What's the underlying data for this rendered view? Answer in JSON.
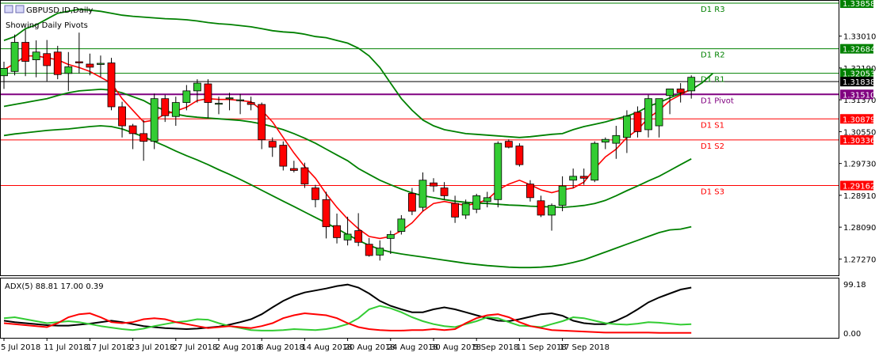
{
  "header": {
    "symbol_label": "GBPUSD.ID,Daily",
    "subtitle": "Showing Daily Pivots",
    "indicator_label": "ADX(5) 88.81 17.00 0.39"
  },
  "colors": {
    "bull": "#33cc33",
    "bear": "#ff0000",
    "bollinger": "#008000",
    "ma": "#ff0000",
    "pivot_green": "#008000",
    "pivot_purple": "#800080",
    "pivot_red": "#ff0000",
    "adx_main": "#000000",
    "adx_plus": "#33cc33",
    "adx_minus": "#ff0000"
  },
  "chart_data": [
    {
      "type": "candlestick",
      "title": "GBPUSD.ID,Daily",
      "y_ticks": [
        "1.33010",
        "1.32190",
        "1.31370",
        "1.30550",
        "1.29730",
        "1.28910",
        "1.28090",
        "1.27270"
      ],
      "x_tick_labels": [
        "5 Jul 2018",
        "11 Jul 2018",
        "17 Jul 2018",
        "23 Jul 2018",
        "27 Jul 2018",
        "2 Aug 2018",
        "8 Aug 2018",
        "14 Aug 2018",
        "20 Aug 2018",
        "24 Aug 2018",
        "30 Aug 2018",
        "5 Sep 2018",
        "11 Sep 2018",
        "17 Sep 2018"
      ],
      "ylim": [
        1.2685,
        1.3392
      ],
      "pivots": [
        {
          "name": "D1 R3",
          "value": 1.33858,
          "tag": "1.33858",
          "color": "pivot_green"
        },
        {
          "name": "D1 R2",
          "value": 1.32684,
          "tag": "1.32684",
          "color": "pivot_green"
        },
        {
          "name": "D1 R1",
          "value": 1.32053,
          "tag": "1.32053",
          "color": "pivot_green"
        },
        {
          "name": "D1 Pivot",
          "value": 1.3151,
          "tag": "1.31510",
          "color": "pivot_purple"
        },
        {
          "name": "D1 S1",
          "value": 1.30879,
          "tag": "1.30879",
          "color": "pivot_red"
        },
        {
          "name": "D1 S2",
          "value": 1.30336,
          "tag": "1.30336",
          "color": "pivot_red"
        },
        {
          "name": "D1 S3",
          "value": 1.29162,
          "tag": "1.29162",
          "color": "pivot_red"
        }
      ],
      "current_price_tag": "1.31838",
      "current_price": 1.31838,
      "ohlc": [
        [
          1.3199,
          1.3235,
          1.3165,
          1.3218
        ],
        [
          1.321,
          1.3305,
          1.32,
          1.3285
        ],
        [
          1.3285,
          1.3318,
          1.3198,
          1.3236
        ],
        [
          1.324,
          1.329,
          1.3195,
          1.326
        ],
        [
          1.3256,
          1.3291,
          1.3185,
          1.3225
        ],
        [
          1.326,
          1.3276,
          1.319,
          1.3202
        ],
        [
          1.3205,
          1.326,
          1.316,
          1.3222
        ],
        [
          1.3235,
          1.331,
          1.3205,
          1.3232
        ],
        [
          1.3229,
          1.3256,
          1.32,
          1.3221
        ],
        [
          1.3228,
          1.3251,
          1.3196,
          1.3231
        ],
        [
          1.3232,
          1.3245,
          1.311,
          1.3119
        ],
        [
          1.3119,
          1.3132,
          1.304,
          1.307
        ],
        [
          1.307,
          1.3075,
          1.301,
          1.305
        ],
        [
          1.305,
          1.3085,
          1.298,
          1.303
        ],
        [
          1.303,
          1.3153,
          1.301,
          1.314
        ],
        [
          1.314,
          1.315,
          1.308,
          1.3096
        ],
        [
          1.3094,
          1.3145,
          1.307,
          1.313
        ],
        [
          1.313,
          1.3175,
          1.311,
          1.316
        ],
        [
          1.316,
          1.319,
          1.313,
          1.318
        ],
        [
          1.3178,
          1.319,
          1.309,
          1.313
        ],
        [
          1.3127,
          1.3145,
          1.31,
          1.3128
        ],
        [
          1.314,
          1.3155,
          1.311,
          1.3142
        ],
        [
          1.3135,
          1.3152,
          1.31,
          1.3137
        ],
        [
          1.313,
          1.3145,
          1.311,
          1.3125
        ],
        [
          1.3125,
          1.313,
          1.301,
          1.3034
        ],
        [
          1.303,
          1.304,
          1.299,
          1.3015
        ],
        [
          1.302,
          1.303,
          1.2955,
          1.2966
        ],
        [
          1.296,
          1.298,
          1.295,
          1.2955
        ],
        [
          1.2962,
          1.2975,
          1.291,
          1.292
        ],
        [
          1.291,
          1.2918,
          1.286,
          1.288
        ],
        [
          1.288,
          1.29,
          1.278,
          1.281
        ],
        [
          1.2813,
          1.2844,
          1.2767,
          1.2782
        ],
        [
          1.2776,
          1.2836,
          1.2762,
          1.2791
        ],
        [
          1.28,
          1.2845,
          1.276,
          1.277
        ],
        [
          1.2765,
          1.2781,
          1.2733,
          1.2736
        ],
        [
          1.2737,
          1.2775,
          1.2723,
          1.2755
        ],
        [
          1.278,
          1.28,
          1.274,
          1.279
        ],
        [
          1.2798,
          1.284,
          1.279,
          1.283
        ],
        [
          1.2896,
          1.291,
          1.284,
          1.285
        ],
        [
          1.286,
          1.295,
          1.285,
          1.293
        ],
        [
          1.2923,
          1.2935,
          1.29,
          1.2915
        ],
        [
          1.291,
          1.2925,
          1.288,
          1.289
        ],
        [
          1.287,
          1.289,
          1.282,
          1.2835
        ],
        [
          1.284,
          1.288,
          1.283,
          1.287
        ],
        [
          1.2855,
          1.2895,
          1.2845,
          1.289
        ],
        [
          1.2875,
          1.29,
          1.286,
          1.2885
        ],
        [
          1.288,
          1.303,
          1.286,
          1.3025
        ],
        [
          1.303,
          1.3035,
          1.3012,
          1.3015
        ],
        [
          1.3018,
          1.3025,
          1.2965,
          1.297
        ],
        [
          1.292,
          1.293,
          1.2875,
          1.2885
        ],
        [
          1.2877,
          1.289,
          1.2835,
          1.284
        ],
        [
          1.284,
          1.287,
          1.28,
          1.2865
        ],
        [
          1.2865,
          1.294,
          1.285,
          1.2915
        ],
        [
          1.293,
          1.296,
          1.291,
          1.294
        ],
        [
          1.294,
          1.296,
          1.2918,
          1.2935
        ],
        [
          1.293,
          1.303,
          1.2925,
          1.3025
        ],
        [
          1.3028,
          1.304,
          1.301,
          1.3035
        ],
        [
          1.3025,
          1.307,
          1.2985,
          1.3045
        ],
        [
          1.304,
          1.311,
          1.3,
          1.3095
        ],
        [
          1.3105,
          1.312,
          1.304,
          1.3055
        ],
        [
          1.306,
          1.315,
          1.304,
          1.314
        ],
        [
          1.307,
          1.313,
          1.304,
          1.314
        ],
        [
          1.3148,
          1.3165,
          1.31,
          1.3165
        ],
        [
          1.3165,
          1.318,
          1.313,
          1.3155
        ],
        [
          1.316,
          1.32,
          1.314,
          1.3195
        ]
      ],
      "upper_band": [
        1.329,
        1.33,
        1.332,
        1.333,
        1.3345,
        1.336,
        1.3365,
        1.337,
        1.3368,
        1.3365,
        1.336,
        1.3355,
        1.3352,
        1.335,
        1.3348,
        1.3346,
        1.3345,
        1.3343,
        1.334,
        1.3336,
        1.3333,
        1.3331,
        1.3328,
        1.3325,
        1.332,
        1.3315,
        1.3312,
        1.331,
        1.3306,
        1.33,
        1.3297,
        1.329,
        1.3283,
        1.327,
        1.325,
        1.322,
        1.318,
        1.314,
        1.311,
        1.3085,
        1.307,
        1.306,
        1.3055,
        1.305,
        1.3048,
        1.3046,
        1.3044,
        1.3042,
        1.304,
        1.3042,
        1.3045,
        1.3048,
        1.305,
        1.306,
        1.3068,
        1.3074,
        1.308,
        1.3088,
        1.3095,
        1.3105,
        1.312,
        1.313,
        1.3142,
        1.3153,
        1.3163,
        1.3181,
        1.3205
      ],
      "middle_band": [
        1.312,
        1.3125,
        1.313,
        1.3135,
        1.314,
        1.3148,
        1.3155,
        1.316,
        1.3162,
        1.3164,
        1.3162,
        1.3155,
        1.3145,
        1.3135,
        1.312,
        1.311,
        1.31,
        1.3095,
        1.3092,
        1.309,
        1.3088,
        1.3086,
        1.3084,
        1.308,
        1.3075,
        1.3068,
        1.306,
        1.305,
        1.3038,
        1.3025,
        1.301,
        1.2995,
        1.298,
        1.296,
        1.2945,
        1.293,
        1.2918,
        1.2907,
        1.2897,
        1.289,
        1.2885,
        1.288,
        1.2876,
        1.2873,
        1.2871,
        1.287,
        1.2868,
        1.2866,
        1.2865,
        1.2863,
        1.2862,
        1.2861,
        1.286,
        1.2862,
        1.2865,
        1.287,
        1.2878,
        1.289,
        1.2903,
        1.2915,
        1.2928,
        1.294,
        1.2955,
        1.297,
        1.2985
      ],
      "lower_band": [
        1.3045,
        1.3049,
        1.3052,
        1.3055,
        1.3058,
        1.306,
        1.3062,
        1.3065,
        1.3068,
        1.307,
        1.3068,
        1.3062,
        1.3052,
        1.3042,
        1.303,
        1.3018,
        1.3005,
        1.2993,
        1.2982,
        1.297,
        1.2957,
        1.2945,
        1.2932,
        1.2918,
        1.2904,
        1.289,
        1.2876,
        1.2862,
        1.2848,
        1.2834,
        1.282,
        1.2805,
        1.279,
        1.2775,
        1.2762,
        1.2752,
        1.2745,
        1.274,
        1.2736,
        1.2732,
        1.2728,
        1.2724,
        1.272,
        1.2716,
        1.2713,
        1.271,
        1.2708,
        1.2706,
        1.2705,
        1.2705,
        1.2706,
        1.2708,
        1.2712,
        1.2718,
        1.2725,
        1.2735,
        1.2745,
        1.2755,
        1.2765,
        1.2775,
        1.2785,
        1.2795,
        1.2802,
        1.2804,
        1.281
      ],
      "ma_line": [
        1.3215,
        1.323,
        1.325,
        1.325,
        1.3245,
        1.324,
        1.3228,
        1.322,
        1.321,
        1.3195,
        1.318,
        1.314,
        1.311,
        1.308,
        1.3085,
        1.31,
        1.3108,
        1.3118,
        1.3135,
        1.314,
        1.3138,
        1.3138,
        1.3135,
        1.3132,
        1.311,
        1.308,
        1.304,
        1.3,
        1.2965,
        1.2935,
        1.2895,
        1.286,
        1.283,
        1.2805,
        1.2785,
        1.278,
        1.2785,
        1.28,
        1.282,
        1.285,
        1.287,
        1.2875,
        1.287,
        1.2865,
        1.287,
        1.288,
        1.2905,
        1.292,
        1.293,
        1.2918,
        1.2905,
        1.2898,
        1.2905,
        1.291,
        1.2925,
        1.296,
        1.299,
        1.301,
        1.304,
        1.306,
        1.309,
        1.311,
        1.3135,
        1.315,
        1.3165
      ]
    },
    {
      "type": "line",
      "title": "ADX(5) 88.81 17.00 0.39",
      "y_ticks": [
        "99.18",
        "0.00"
      ],
      "ylim": [
        0,
        99.18
      ],
      "series": [
        {
          "name": "ADX",
          "color": "adx_main",
          "values": [
            25,
            22,
            20,
            18,
            16,
            15,
            15,
            17,
            19,
            22,
            25,
            22,
            18,
            14,
            12,
            10,
            9,
            8,
            9,
            11,
            13,
            17,
            22,
            28,
            38,
            52,
            65,
            75,
            82,
            86,
            90,
            95,
            98,
            92,
            80,
            65,
            55,
            48,
            42,
            42,
            48,
            52,
            48,
            42,
            36,
            30,
            25,
            24,
            28,
            33,
            38,
            40,
            35,
            25,
            20,
            18,
            18,
            25,
            35,
            48,
            62,
            72,
            80,
            88,
            92
          ]
        },
        {
          "name": "+DI",
          "color": "adx_plus",
          "values": [
            30,
            32,
            28,
            24,
            20,
            22,
            24,
            22,
            18,
            14,
            11,
            8,
            6,
            9,
            14,
            18,
            22,
            24,
            28,
            27,
            20,
            14,
            10,
            6,
            5,
            5,
            6,
            8,
            7,
            6,
            8,
            12,
            18,
            30,
            48,
            55,
            50,
            42,
            32,
            24,
            18,
            14,
            12,
            18,
            24,
            32,
            30,
            22,
            15,
            14,
            12,
            18,
            24,
            32,
            30,
            25,
            20,
            18,
            17,
            19,
            22,
            21,
            19,
            17,
            18
          ]
        },
        {
          "name": "-DI",
          "color": "adx_minus",
          "values": [
            20,
            18,
            16,
            14,
            12,
            20,
            32,
            38,
            40,
            32,
            22,
            20,
            22,
            28,
            30,
            28,
            22,
            18,
            14,
            10,
            12,
            14,
            12,
            10,
            14,
            20,
            30,
            36,
            40,
            38,
            36,
            30,
            20,
            12,
            8,
            6,
            5,
            5,
            6,
            6,
            8,
            6,
            8,
            20,
            30,
            36,
            38,
            32,
            22,
            14,
            10,
            6,
            5,
            4,
            3,
            2,
            1,
            1,
            1,
            1,
            1,
            0.5,
            0.4,
            0.4,
            0.4
          ]
        }
      ]
    }
  ]
}
